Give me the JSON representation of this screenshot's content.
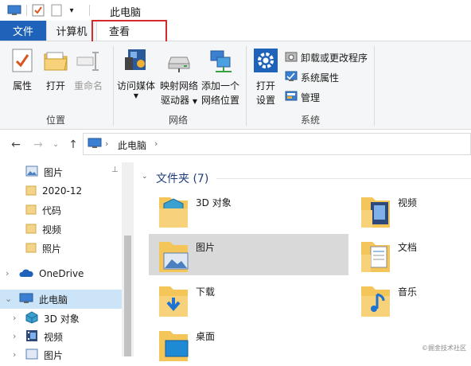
{
  "window": {
    "title": "此电脑"
  },
  "ribbon_tabs": {
    "file": "文件",
    "computer": "计算机",
    "view": "查看"
  },
  "ribbon": {
    "location": {
      "label": "位置",
      "buttons": [
        {
          "label": "属性",
          "icon": "properties-icon",
          "enabled": true
        },
        {
          "label": "打开",
          "icon": "open-folder-icon",
          "enabled": true
        },
        {
          "label": "重命名",
          "icon": "rename-icon",
          "enabled": false
        }
      ]
    },
    "network": {
      "label": "网络",
      "buttons": [
        {
          "label": "访问媒体",
          "icon": "media-icon",
          "enabled": true
        },
        {
          "label_line1": "映射网络",
          "label_line2": "驱动器",
          "icon": "map-drive-icon",
          "enabled": true
        },
        {
          "label_line1": "添加一个",
          "label_line2": "网络位置",
          "icon": "network-location-icon",
          "enabled": true
        }
      ]
    },
    "system": {
      "label": "系统",
      "open_settings": {
        "label_line1": "打开",
        "label_line2": "设置"
      },
      "small_buttons": [
        {
          "label": "卸载或更改程序",
          "icon": "uninstall-icon"
        },
        {
          "label": "系统属性",
          "icon": "system-properties-icon"
        },
        {
          "label": "管理",
          "icon": "manage-icon"
        }
      ]
    }
  },
  "address": {
    "path": "此电脑"
  },
  "nav_pane": {
    "items": [
      {
        "label": "图片",
        "icon": "pictures-icon",
        "pinned": true
      },
      {
        "label": "2020-12",
        "icon": "folder-icon"
      },
      {
        "label": "代码",
        "icon": "folder-icon"
      },
      {
        "label": "视频",
        "icon": "folder-icon"
      },
      {
        "label": "照片",
        "icon": "folder-icon"
      },
      {
        "label": "OneDrive",
        "icon": "onedrive-icon"
      },
      {
        "label": "此电脑",
        "icon": "this-pc-icon",
        "selected": true
      },
      {
        "label": "3D 对象",
        "icon": "3d-objects-icon"
      },
      {
        "label": "视频",
        "icon": "videos-icon"
      },
      {
        "label": "图片",
        "icon": "pictures-icon"
      }
    ]
  },
  "content": {
    "group_header": "文件夹 (7)",
    "folders": [
      {
        "label": "3D 对象",
        "icon": "3d-objects-folder-icon"
      },
      {
        "label": "视频",
        "icon": "videos-folder-icon"
      },
      {
        "label": "图片",
        "icon": "pictures-folder-icon",
        "selected": true
      },
      {
        "label": "文档",
        "icon": "documents-folder-icon"
      },
      {
        "label": "下载",
        "icon": "downloads-folder-icon"
      },
      {
        "label": "音乐",
        "icon": "music-folder-icon"
      },
      {
        "label": "桌面",
        "icon": "desktop-folder-icon"
      }
    ]
  },
  "watermark": "©掘金技术社区",
  "colors": {
    "accent": "#1e62b9",
    "highlight_box": "#d52a2a",
    "folder": "#f4c65a",
    "selected_bg": "#d9d9d9"
  }
}
